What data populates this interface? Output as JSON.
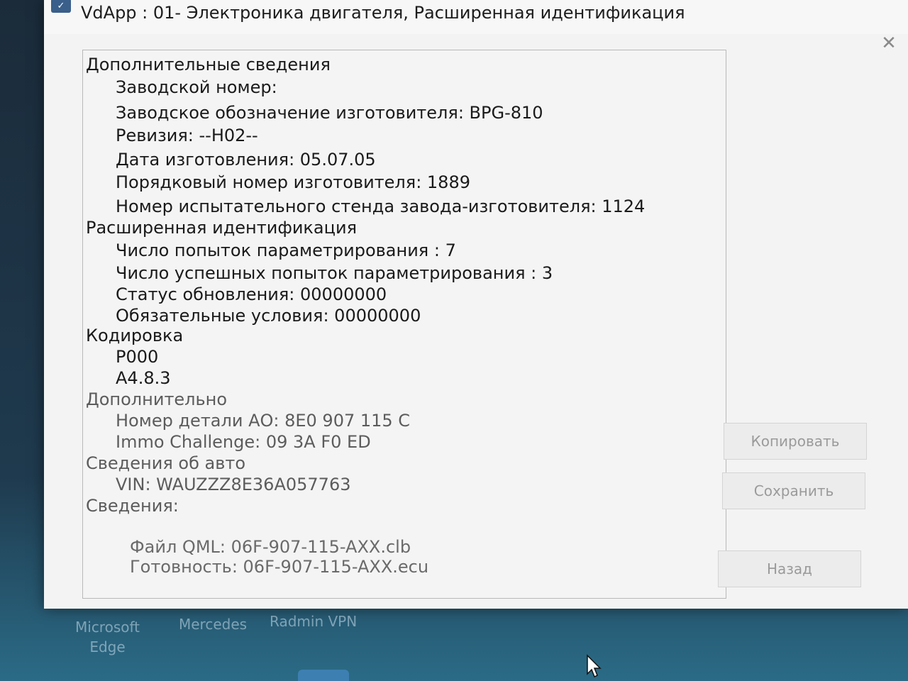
{
  "window": {
    "title": "VdApp : 01- Электроника двигателя,  Расширенная идентификация",
    "app_icon": "app-logo-icon",
    "close_icon": "close-icon",
    "close_glyph": "✕"
  },
  "info": {
    "lines": [
      {
        "text": "Дополнительные сведения",
        "kind": "section"
      },
      {
        "text": "Заводской номер:",
        "kind": "item"
      },
      {
        "text": "Заводское обозначение изготовителя: BPG-810",
        "kind": "item"
      },
      {
        "text": "Ревизия: --H02--",
        "kind": "item"
      },
      {
        "text": "Дата изготовления: 05.07.05",
        "kind": "item"
      },
      {
        "text": "Порядковый номер изготовителя: 1889",
        "kind": "item"
      },
      {
        "text": "Номер испытательного стенда завода-изготовителя: 1124",
        "kind": "item"
      },
      {
        "text": "Расширенная идентификация",
        "kind": "section"
      },
      {
        "text": "Число попыток параметрирования : 7",
        "kind": "item"
      },
      {
        "text": "Число успешных попыток параметрирования : 3",
        "kind": "item"
      },
      {
        "text": "Статус обновления: 00000000",
        "kind": "item"
      },
      {
        "text": "Обязательные условия: 00000000",
        "kind": "item"
      },
      {
        "text": "Кодировка",
        "kind": "section"
      },
      {
        "text": "P000",
        "kind": "item"
      },
      {
        "text": "A4.8.3",
        "kind": "item"
      },
      {
        "text": "Дополнительно",
        "kind": "section"
      },
      {
        "text": "Номер детали АО: 8E0 907 115 C",
        "kind": "item"
      },
      {
        "text": "Immo Challenge: 09 3A F0 ED",
        "kind": "item"
      },
      {
        "text": "Сведения об авто",
        "kind": "section"
      },
      {
        "text": "VIN: WAUZZZ8E36A057763",
        "kind": "item"
      },
      {
        "text": "Сведения:",
        "kind": "section"
      },
      {
        "text": "Файл QML: 06F-907-115-AXX.clb",
        "kind": "item"
      },
      {
        "text": "Готовность: 06F-907-115-AXX.ecu",
        "kind": "item"
      }
    ]
  },
  "buttons": {
    "copy": "Копировать",
    "save": "Сохранить",
    "back": "Назад"
  },
  "desktop": {
    "shortcuts": [
      {
        "label": "Microsoft\nEdge"
      },
      {
        "label": "Mercedes"
      },
      {
        "label": "Radmin VPN"
      }
    ],
    "cursor_icon": "mouse-pointer-icon"
  }
}
